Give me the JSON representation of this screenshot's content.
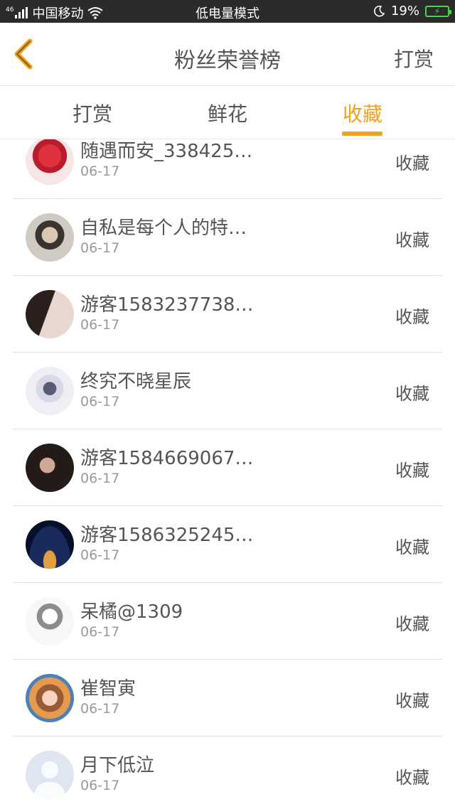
{
  "status_bar": {
    "signal_label": "46",
    "carrier": "中国移动",
    "center_text": "低电量模式",
    "battery": "19%",
    "battery_level": 0.19
  },
  "nav": {
    "title": "粉丝荣誉榜",
    "action": "打赏"
  },
  "tabs": [
    {
      "label": "打赏"
    },
    {
      "label": "鲜花"
    },
    {
      "label": "收藏",
      "active": true
    }
  ],
  "rows": [
    {
      "name": "随遇而安_338425…",
      "date": "06-17",
      "action": "收藏"
    },
    {
      "name": "自私是每个人的特…",
      "date": "06-17",
      "action": "收藏"
    },
    {
      "name": "游客1583237738…",
      "date": "06-17",
      "action": "收藏"
    },
    {
      "name": "终究不晓星辰",
      "date": "06-17",
      "action": "收藏"
    },
    {
      "name": "游客1584669067…",
      "date": "06-17",
      "action": "收藏"
    },
    {
      "name": "游客1586325245…",
      "date": "06-17",
      "action": "收藏"
    },
    {
      "name": "呆橘@1309",
      "date": "06-17",
      "action": "收藏"
    },
    {
      "name": "崔智寅",
      "date": "06-17",
      "action": "收藏"
    },
    {
      "name": "月下低泣",
      "date": "06-17",
      "action": "收藏"
    }
  ],
  "colors": {
    "accent": "#f0a21b",
    "status_bar_bg": "#2b2b2b",
    "battery_green": "#4cd24c"
  },
  "icons": {
    "back": "chevron-left-icon",
    "wifi": "wifi-icon",
    "moon": "moon-icon",
    "battery": "battery-charging-icon"
  }
}
